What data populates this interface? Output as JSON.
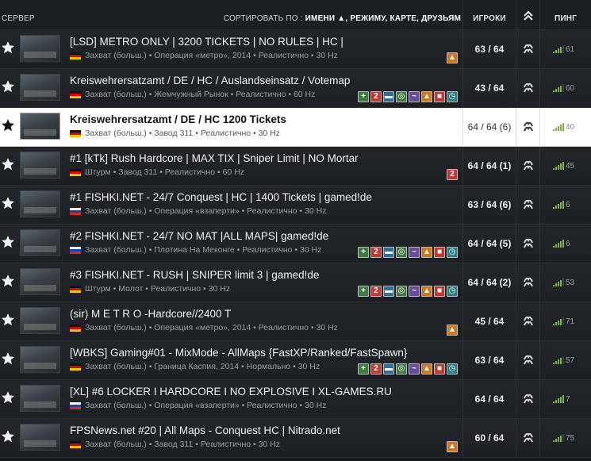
{
  "header": {
    "server_label": "СЕРВЕР",
    "sort_prefix": "СОРТИРОВАТЬ ПО :",
    "sort_options": [
      "ИМЕНИ ▲",
      "РЕЖИМУ",
      "КАРТЕ",
      "ДРУЗЬЯМ"
    ],
    "players_label": "ИГРОКИ",
    "ping_label": "ПИНГ",
    "rank_icon": "rank-chevron-icon"
  },
  "colors": {
    "row_bg": "#22262a",
    "selected_row_bg": "#ffffff",
    "ping_green": "#7ab83a",
    "badge_orange": "#d0781c",
    "badge_red": "#c23a2f",
    "badge_green": "#3f7a43"
  },
  "servers": [
    {
      "title": "[LSD] METRO ONLY | 3200 TICKETS | NO RULES | HC |",
      "flag": "de",
      "details": "Захват (больш.) • Операция «метро», 2014 • Реалистично • 30 Hz",
      "players": "63 / 64",
      "ping": "61",
      "badges": [
        "fire"
      ],
      "selected": false
    },
    {
      "title": "Kreiswehrersatzamt / DE / HC / Auslandseinsatz / Votemap",
      "flag": "de",
      "details": "Захват (больш.) • Жемчужный Рынок • Реалистично • 60 Hz",
      "players": "43 / 64",
      "ping": "60",
      "badges": [
        "medic",
        "two",
        "boat",
        "spot",
        "wave",
        "fire",
        "stop",
        "timer"
      ],
      "selected": false
    },
    {
      "title": "Kreiswehrersatzamt / DE / HC 1200 Tickets",
      "flag": "de",
      "details": "Захват (больш.) • Завод 311 • Реалистично • 30 Hz",
      "players": "64 / 64 (6)",
      "ping": "40",
      "badges": [],
      "selected": true
    },
    {
      "title": "#1 [kTk] Rush Hardcore | MAX TIX | Sniper Limit | NO Mortar",
      "flag": "de",
      "details": "Штурм • Завод 311 • Реалистично • 60 Hz",
      "players": "64 / 64 (1)",
      "ping": "45",
      "badges": [
        "two"
      ],
      "selected": false
    },
    {
      "title": "#1 FISHKI.NET - 24/7 Conquest | HC | 1400 Tickets | gamed!de",
      "flag": "ru",
      "details": "Захват (больш.) • Операция «взаперти» • Реалистично • 30 Hz",
      "players": "63 / 64 (6)",
      "ping": "6",
      "badges": [],
      "selected": false
    },
    {
      "title": "#2 FISHKI.NET - 24/7 NO MAT |ALL MAPS| gamed!de",
      "flag": "ru",
      "details": "Захват (больш.) • Плотина На Меконге • Реалистично • 30 Hz",
      "players": "64 / 64 (5)",
      "ping": "6",
      "badges": [
        "medic",
        "two",
        "boat",
        "spot",
        "wave",
        "fire",
        "stop",
        "timer"
      ],
      "selected": false
    },
    {
      "title": "#3 FISHKI.NET - RUSH | SNIPER limit 3 | gamed!de",
      "flag": "de",
      "details": "Штурм • Молот • Реалистично • 30 Hz",
      "players": "64 / 64 (2)",
      "ping": "53",
      "badges": [
        "medic",
        "two",
        "boat",
        "spot",
        "wave",
        "fire",
        "stop",
        "timer"
      ],
      "selected": false
    },
    {
      "title": "(sir) M E T R O -Hardcore//2400 T",
      "flag": "de",
      "details": "Захват (больш.) • Операция «метро», 2014 • Реалистично • 30 Hz",
      "players": "45 / 64",
      "ping": "71",
      "badges": [
        "fire"
      ],
      "selected": false
    },
    {
      "title": "[WBKS] Gaming#01 - MixMode - AllMaps {FastXP/Ranked/FastSpawn}",
      "flag": "de",
      "details": "Захват (больш.) • Граница Каспия, 2014 • Нормально • 30 Hz",
      "players": "63 / 64",
      "ping": "57",
      "badges": [
        "medic",
        "two",
        "boat",
        "spot",
        "wave",
        "fire",
        "stop",
        "timer"
      ],
      "selected": false
    },
    {
      "title": "[XL] #6 LOCKER I HARDCORE I NO EXPLOSIVE I XL-GAMES.RU",
      "flag": "ru",
      "details": "Захват (больш.) • Операция «взаперти» • Реалистично • 30 Hz",
      "players": "64 / 64",
      "ping": "7",
      "badges": [],
      "selected": false
    },
    {
      "title": "FPSNews.net #20 | All Maps - Conquest HC | Nitrado.net",
      "flag": "de",
      "details": "Захват (больш.) • Завод 311 • Реалистично • 30 Hz",
      "players": "60 / 64",
      "ping": "75",
      "badges": [
        "fire"
      ],
      "selected": false
    }
  ]
}
